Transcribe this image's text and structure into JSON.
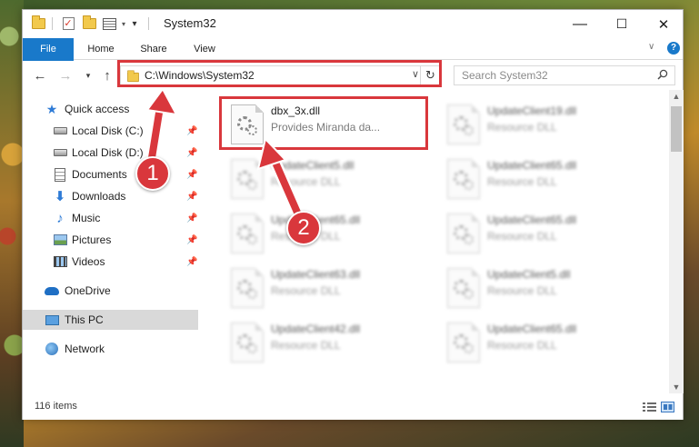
{
  "window": {
    "title": "System32",
    "controls": {
      "minimize": "—",
      "maximize": "☐",
      "close": "✕"
    }
  },
  "ribbon": {
    "tabs": [
      "File",
      "Home",
      "Share",
      "View"
    ],
    "help": "?"
  },
  "address_bar": {
    "path": "C:\\Windows\\System32",
    "search_placeholder": "Search System32"
  },
  "nav_pane": {
    "items": [
      {
        "label": "Quick access",
        "icon": "star-icon"
      },
      {
        "label": "Local Disk (C:)",
        "icon": "drive-icon",
        "pinned": true
      },
      {
        "label": "Local Disk (D:)",
        "icon": "drive-icon",
        "pinned": true
      },
      {
        "label": "Documents",
        "icon": "documents-icon",
        "pinned": true
      },
      {
        "label": "Downloads",
        "icon": "downloads-icon",
        "pinned": true
      },
      {
        "label": "Music",
        "icon": "music-icon",
        "pinned": true
      },
      {
        "label": "Pictures",
        "icon": "pictures-icon",
        "pinned": true
      },
      {
        "label": "Videos",
        "icon": "videos-icon",
        "pinned": true
      },
      {
        "label": "OneDrive",
        "icon": "onedrive-icon"
      },
      {
        "label": "This PC",
        "icon": "this-pc-icon",
        "selected": true
      },
      {
        "label": "Network",
        "icon": "network-icon"
      }
    ]
  },
  "files": [
    {
      "name": "dbx_3x.dll",
      "description": "Provides Miranda da..."
    },
    {
      "name": "UpdateClient19.dll",
      "description": "Resource DLL"
    },
    {
      "name": "UpdateClient5.dll",
      "description": "Resource DLL"
    },
    {
      "name": "UpdateClient65.dll",
      "description": "Resource DLL"
    },
    {
      "name": "UpdateClient65.dll",
      "description": "Resource DLL"
    },
    {
      "name": "UpdateClient65.dll",
      "description": "Resource DLL"
    },
    {
      "name": "UpdateClient63.dll",
      "description": "Resource DLL"
    },
    {
      "name": "UpdateClient5.dll",
      "description": "Resource DLL"
    },
    {
      "name": "UpdateClient42.dll",
      "description": "Resource DLL"
    },
    {
      "name": "UpdateClient65.dll",
      "description": "Resource DLL"
    }
  ],
  "status_bar": {
    "item_count": "116 items"
  },
  "annotations": {
    "step1": "1",
    "step2": "2"
  },
  "colors": {
    "accent": "#1979ca",
    "annotation_red": "#d9373c"
  }
}
